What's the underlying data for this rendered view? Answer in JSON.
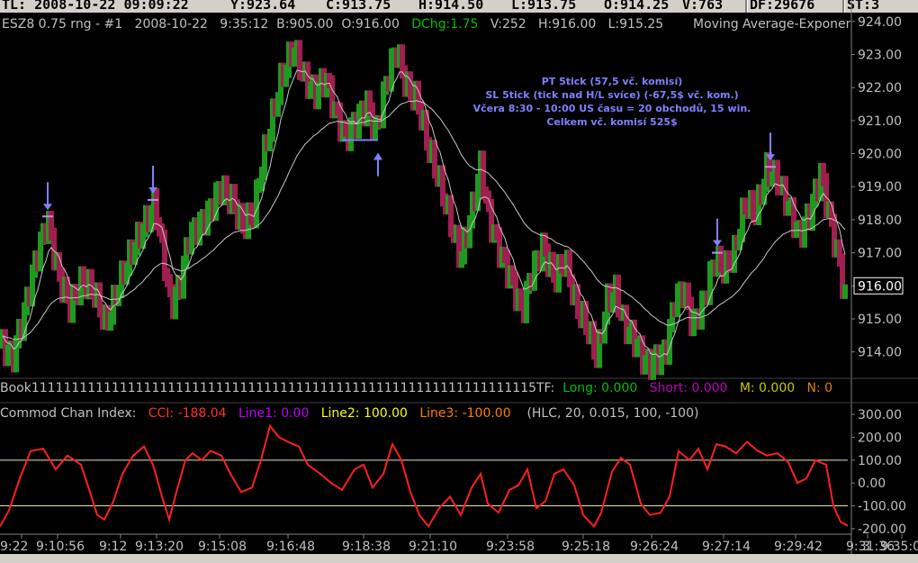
{
  "top_bar": {
    "tl": "TL: 2008-10-22  09:09:22",
    "y": "Y:923.64",
    "c": "C:913.75",
    "h": "H:914.50",
    "l": "L:913.75",
    "o": "O:914.25",
    "v": "V:763",
    "df": "DF:29676",
    "st": "ST:3"
  },
  "header": {
    "symbol": "ESZ8  0.75 rng - #1",
    "date": "2008-10-22",
    "time": "9:35:12",
    "b": "B:905.00",
    "o": "O:916.00",
    "dchg": "DChg:1.75",
    "v": "V:252",
    "h": "H:916.00",
    "l": "L:915.25",
    "indicator": "Moving Average-Exponen"
  },
  "book_line": {
    "book": "Book111111111111111111111111111111111111111111111111111111111111115",
    "tf": "TF:",
    "long": "Long: 0.000",
    "short": "Short: 0.000",
    "m": "M: 0.000",
    "n": "N: 0"
  },
  "cci_header": {
    "name": "Commod Chan Index:",
    "cci": "CCI: -188.04",
    "line1": "Line1: 0.00",
    "line2": "Line2: 100.00",
    "line3": "Line3: -100.00",
    "params": "(HLC, 20, 0.015, 100, -100)"
  },
  "annotation": {
    "line1": "PT 5tick (57,5 vč. komisí)",
    "line2": "SL 5tick (tick nad H/L svíce) (-67,5$ vč. kom.)",
    "line3": "Včera 8:30 - 10:00 US času = 20 obchodů, 15 win.",
    "line4": "Celkem vč. komisí 525$"
  },
  "colors": {
    "up": "#1e9a1e",
    "down": "#a01e50",
    "ema": "#c8c8c8",
    "cci": "#ff2020",
    "level_line": "#e8e8a0",
    "arrow": "#8080ff",
    "dchg": "#00c000",
    "long": "#00c000",
    "short": "#c000c0",
    "m": "#c8c800",
    "n": "#e08000",
    "line1": "#c000ff",
    "line2": "#ffff00",
    "line3": "#ff8000"
  },
  "chart_data": [
    {
      "type": "candlestick",
      "title": "ESZ8 0.75 rng",
      "price_axis_labels": [
        "924.00",
        "923.00",
        "922.00",
        "921.00",
        "920.00",
        "919.00",
        "918.00",
        "917.00",
        "916.00",
        "915.00",
        "914.00"
      ],
      "ylim": [
        913.2,
        924.05
      ],
      "last_price": "916.00",
      "time_labels": [
        "9:22",
        "9:10:56",
        "9:12",
        "9:13:20",
        "9:15:08",
        "9:16:48",
        "9:18:38",
        "9:21:10",
        "9:23:58",
        "9:25:18",
        "9:26:24",
        "9:27:14",
        "9:29:42",
        "9:31:36",
        "9:35:02",
        "3"
      ],
      "close_path": [
        [
          0,
          914.3
        ],
        [
          14,
          913.8
        ],
        [
          28,
          915.3
        ],
        [
          40,
          916.8
        ],
        [
          53,
          918.0
        ],
        [
          65,
          916.3
        ],
        [
          78,
          915.4
        ],
        [
          92,
          916.2
        ],
        [
          105,
          915.8
        ],
        [
          118,
          914.8
        ],
        [
          132,
          916.0
        ],
        [
          146,
          917.0
        ],
        [
          160,
          917.8
        ],
        [
          172,
          918.5
        ],
        [
          180,
          917.2
        ],
        [
          190,
          915.4
        ],
        [
          200,
          916.0
        ],
        [
          210,
          917.5
        ],
        [
          220,
          917.8
        ],
        [
          232,
          918.2
        ],
        [
          245,
          919.0
        ],
        [
          258,
          918.6
        ],
        [
          270,
          917.8
        ],
        [
          282,
          918.2
        ],
        [
          292,
          919.8
        ],
        [
          302,
          921.0
        ],
        [
          312,
          922.2
        ],
        [
          326,
          923.2
        ],
        [
          338,
          922.3
        ],
        [
          350,
          921.8
        ],
        [
          362,
          922.3
        ],
        [
          372,
          921.3
        ],
        [
          384,
          920.5
        ],
        [
          396,
          921.0
        ],
        [
          408,
          921.5
        ],
        [
          418,
          920.6
        ],
        [
          428,
          922.0
        ],
        [
          440,
          923.2
        ],
        [
          452,
          922.0
        ],
        [
          464,
          921.6
        ],
        [
          476,
          920.2
        ],
        [
          488,
          919.2
        ],
        [
          500,
          918.0
        ],
        [
          512,
          916.8
        ],
        [
          524,
          918.2
        ],
        [
          534,
          919.6
        ],
        [
          544,
          918.0
        ],
        [
          556,
          917.0
        ],
        [
          568,
          916.2
        ],
        [
          580,
          915.2
        ],
        [
          592,
          916.5
        ],
        [
          604,
          917.2
        ],
        [
          616,
          916.2
        ],
        [
          628,
          916.8
        ],
        [
          640,
          915.4
        ],
        [
          652,
          914.8
        ],
        [
          664,
          913.8
        ],
        [
          674,
          915.5
        ],
        [
          684,
          915.8
        ],
        [
          694,
          914.8
        ],
        [
          706,
          914.3
        ],
        [
          718,
          913.6
        ],
        [
          730,
          913.8
        ],
        [
          740,
          914.0
        ],
        [
          750,
          915.6
        ],
        [
          760,
          915.9
        ],
        [
          770,
          914.8
        ],
        [
          782,
          915.5
        ],
        [
          794,
          916.8
        ],
        [
          806,
          916.5
        ],
        [
          816,
          917.0
        ],
        [
          828,
          918.5
        ],
        [
          840,
          918.2
        ],
        [
          852,
          919.5
        ],
        [
          864,
          919.2
        ],
        [
          876,
          918.4
        ],
        [
          888,
          917.5
        ],
        [
          900,
          918.2
        ],
        [
          912,
          919.4
        ],
        [
          924,
          917.8
        ],
        [
          934,
          916.5
        ],
        [
          942,
          915.1
        ]
      ],
      "trade_markers": [
        {
          "bar_x": 53,
          "price": 918.1,
          "direction": "down"
        },
        {
          "bar_x": 170,
          "price": 918.6,
          "direction": "down"
        },
        {
          "bar_x": 400,
          "price": 920.3,
          "direction": "up"
        },
        {
          "bar_x": 797,
          "price": 917.0,
          "direction": "down"
        },
        {
          "bar_x": 856,
          "price": 919.6,
          "direction": "down"
        }
      ]
    },
    {
      "type": "line",
      "title": "Commod Chan Index",
      "y_axis_labels": [
        "300.00",
        "200.00",
        "100.00",
        "0.00",
        "-100.00",
        "-200.00"
      ],
      "ylim": [
        -220,
        320
      ],
      "levels": [
        100,
        -100
      ],
      "points": [
        [
          0,
          -190
        ],
        [
          10,
          -120
        ],
        [
          22,
          20
        ],
        [
          34,
          140
        ],
        [
          48,
          150
        ],
        [
          62,
          60
        ],
        [
          75,
          120
        ],
        [
          90,
          80
        ],
        [
          100,
          -40
        ],
        [
          108,
          -140
        ],
        [
          116,
          -160
        ],
        [
          126,
          -80
        ],
        [
          136,
          40
        ],
        [
          148,
          120
        ],
        [
          160,
          160
        ],
        [
          170,
          80
        ],
        [
          180,
          -60
        ],
        [
          188,
          -160
        ],
        [
          196,
          -40
        ],
        [
          206,
          100
        ],
        [
          214,
          130
        ],
        [
          224,
          100
        ],
        [
          234,
          140
        ],
        [
          246,
          120
        ],
        [
          256,
          40
        ],
        [
          268,
          -40
        ],
        [
          280,
          -20
        ],
        [
          290,
          100
        ],
        [
          300,
          250
        ],
        [
          310,
          200
        ],
        [
          320,
          180
        ],
        [
          332,
          160
        ],
        [
          342,
          80
        ],
        [
          356,
          40
        ],
        [
          368,
          0
        ],
        [
          380,
          -30
        ],
        [
          394,
          60
        ],
        [
          404,
          80
        ],
        [
          414,
          -20
        ],
        [
          426,
          40
        ],
        [
          436,
          170
        ],
        [
          446,
          100
        ],
        [
          456,
          -40
        ],
        [
          466,
          -140
        ],
        [
          476,
          -190
        ],
        [
          488,
          -110
        ],
        [
          500,
          -60
        ],
        [
          512,
          -140
        ],
        [
          524,
          -20
        ],
        [
          534,
          40
        ],
        [
          542,
          -90
        ],
        [
          554,
          -130
        ],
        [
          566,
          -30
        ],
        [
          576,
          -10
        ],
        [
          586,
          60
        ],
        [
          596,
          -110
        ],
        [
          606,
          -80
        ],
        [
          616,
          40
        ],
        [
          626,
          60
        ],
        [
          638,
          -10
        ],
        [
          648,
          -140
        ],
        [
          660,
          -190
        ],
        [
          668,
          -130
        ],
        [
          680,
          50
        ],
        [
          690,
          110
        ],
        [
          700,
          80
        ],
        [
          712,
          -90
        ],
        [
          722,
          -140
        ],
        [
          734,
          -130
        ],
        [
          744,
          -60
        ],
        [
          754,
          140
        ],
        [
          766,
          100
        ],
        [
          776,
          150
        ],
        [
          786,
          60
        ],
        [
          796,
          170
        ],
        [
          806,
          160
        ],
        [
          818,
          130
        ],
        [
          830,
          180
        ],
        [
          842,
          140
        ],
        [
          852,
          120
        ],
        [
          864,
          130
        ],
        [
          876,
          90
        ],
        [
          886,
          0
        ],
        [
          896,
          20
        ],
        [
          906,
          100
        ],
        [
          918,
          80
        ],
        [
          926,
          -100
        ],
        [
          934,
          -170
        ],
        [
          942,
          -188
        ]
      ]
    }
  ]
}
